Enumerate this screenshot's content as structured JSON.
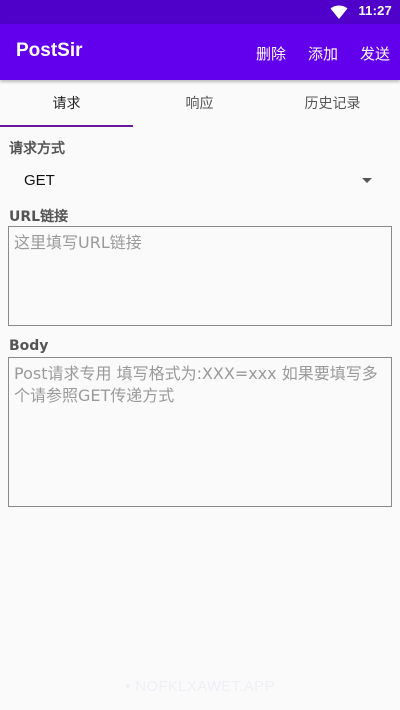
{
  "status_bar": {
    "time": "11:27",
    "wifi_icon": "wifi-icon"
  },
  "app_bar": {
    "title": "PostSir",
    "actions": {
      "delete": "删除",
      "add": "添加",
      "send": "发送"
    }
  },
  "tabs": [
    {
      "label": "请求",
      "active": true
    },
    {
      "label": "响应",
      "active": false
    },
    {
      "label": "历史记录",
      "active": false
    }
  ],
  "form": {
    "method_label": "请求方式",
    "method_value": "GET",
    "url_label": "URL链接",
    "url_placeholder": "这里填写URL链接",
    "url_value": "",
    "body_label": "Body",
    "body_placeholder": "Post请求专用 填写格式为:XXX=xxx 如果要填写多个请参照GET传递方式",
    "body_value": ""
  },
  "watermark": "• NOFKLXAWET.APP",
  "colors": {
    "status_bar": "#4f00c9",
    "app_bar": "#6200ee",
    "tab_indicator": "#6a1b9a",
    "background": "#fafafa"
  }
}
